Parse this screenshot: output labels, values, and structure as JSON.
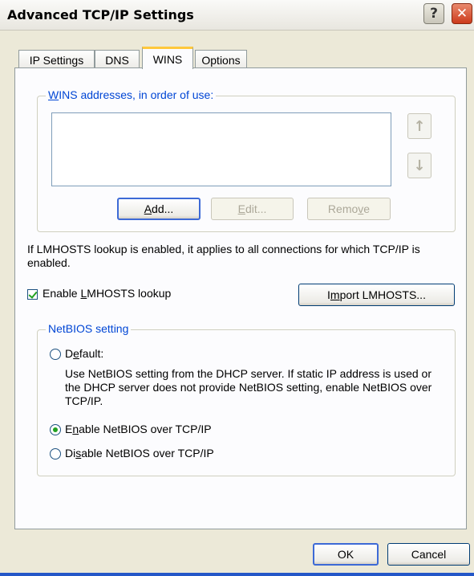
{
  "window": {
    "title": "Advanced TCP/IP Settings",
    "help_glyph": "?",
    "close_glyph": "✕"
  },
  "tabs": [
    {
      "label": "IP Settings",
      "active": false
    },
    {
      "label": "DNS",
      "active": false
    },
    {
      "label": "WINS",
      "active": true
    },
    {
      "label": "Options",
      "active": false
    }
  ],
  "wins": {
    "group_label_first": "W",
    "group_label_rest": "INS addresses, in order of use:",
    "addresses": [],
    "up_glyph": "↑",
    "down_glyph": "↓",
    "add_first": "A",
    "add_rest": "dd...",
    "edit_first": "E",
    "edit_rest": "dit...",
    "remove_pre": "Remo",
    "remove_u": "v",
    "remove_post": "e"
  },
  "lmhosts": {
    "description": "If LMHOSTS lookup is enabled, it applies to all connections for which TCP/IP is enabled.",
    "checkbox_pre": "Enable ",
    "checkbox_u": "L",
    "checkbox_post": "MHOSTS lookup",
    "checked": true,
    "import_pre": "I",
    "import_u": "m",
    "import_post": "port LMHOSTS..."
  },
  "netbios": {
    "group_label": "NetBIOS setting",
    "default_pre": "D",
    "default_u": "e",
    "default_post": "fault:",
    "default_description": "Use NetBIOS setting from the DHCP server. If static IP address is used or the DHCP server does not provide NetBIOS setting, enable NetBIOS over TCP/IP.",
    "enable_pre": "E",
    "enable_u": "n",
    "enable_post": "able NetBIOS over TCP/IP",
    "disable_pre": "Di",
    "disable_u": "s",
    "disable_post": "able NetBIOS over TCP/IP",
    "selected": "enable"
  },
  "footer": {
    "ok_label": "OK",
    "cancel_label": "Cancel"
  }
}
